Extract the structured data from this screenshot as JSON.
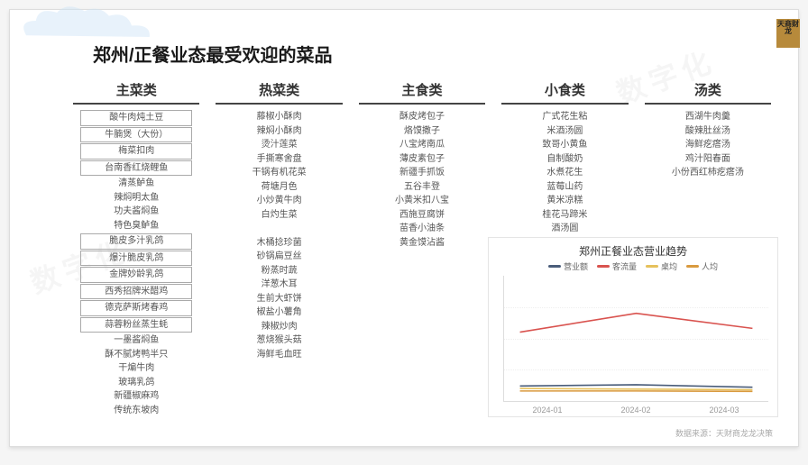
{
  "title": "郑州/正餐业态最受欢迎的菜品",
  "logo": "天商财龙",
  "columns": [
    {
      "header": "主菜类",
      "items": [
        {
          "t": "酸牛肉炖土豆",
          "b": 1
        },
        {
          "t": "牛腩煲（大份）",
          "b": 1
        },
        {
          "t": "梅菜扣肉",
          "b": 1
        },
        {
          "t": "台南香红烧鲤鱼",
          "b": 1
        },
        {
          "t": "清蒸鲈鱼",
          "b": 0
        },
        {
          "t": "辣焖明太鱼",
          "b": 0
        },
        {
          "t": "功夫酱焖鱼",
          "b": 0
        },
        {
          "t": "特色臭鲈鱼",
          "b": 0
        },
        {
          "t": "脆皮多汁乳鸽",
          "b": 1
        },
        {
          "t": "爆汁脆皮乳鸽",
          "b": 1
        },
        {
          "t": "金牌妙龄乳鸽",
          "b": 1
        },
        {
          "t": "西秀招牌米醋鸡",
          "b": 1
        },
        {
          "t": "德克萨斯烤春鸡",
          "b": 1
        },
        {
          "t": "蒜蓉粉丝蒸生蚝",
          "b": 1
        },
        {
          "t": "一墨酱焖鱼",
          "b": 0
        },
        {
          "t": "酥不腻烤鸭半只",
          "b": 0
        },
        {
          "t": "干煸牛肉",
          "b": 0
        },
        {
          "t": "玻璃乳鸽",
          "b": 0
        },
        {
          "t": "新疆椒麻鸡",
          "b": 0
        },
        {
          "t": "传统东坡肉",
          "b": 0
        }
      ]
    },
    {
      "header": "热菜类",
      "items": [
        {
          "t": "藤椒小酥肉",
          "b": 0
        },
        {
          "t": "辣焖小酥肉",
          "b": 0
        },
        {
          "t": "烫汁莲菜",
          "b": 0
        },
        {
          "t": "手撕寒舍盘",
          "b": 0
        },
        {
          "t": "干锅有机花菜",
          "b": 0
        },
        {
          "t": "荷塘月色",
          "b": 0
        },
        {
          "t": "小炒黄牛肉",
          "b": 0
        },
        {
          "t": "白灼生菜",
          "b": 0
        },
        {
          "t": "",
          "b": 0
        },
        {
          "t": "木桶捻珍菌",
          "b": 0
        },
        {
          "t": "砂锅扁豆丝",
          "b": 0
        },
        {
          "t": "粉蒸时蔬",
          "b": 0
        },
        {
          "t": "洋葱木耳",
          "b": 0
        },
        {
          "t": "生前大虾饼",
          "b": 0
        },
        {
          "t": "椒盐小薯角",
          "b": 0
        },
        {
          "t": "辣椒炒肉",
          "b": 0
        },
        {
          "t": "葱烧猴头菇",
          "b": 0
        },
        {
          "t": "海鲜毛血旺",
          "b": 0
        }
      ]
    },
    {
      "header": "主食类",
      "items": [
        {
          "t": "酥皮烤包子",
          "b": 0
        },
        {
          "t": "烙馍撒子",
          "b": 0
        },
        {
          "t": "八宝烤南瓜",
          "b": 0
        },
        {
          "t": "薄皮素包子",
          "b": 0
        },
        {
          "t": "新疆手抓饭",
          "b": 0
        },
        {
          "t": "五谷丰登",
          "b": 0
        },
        {
          "t": "小黄米扣八宝",
          "b": 0
        },
        {
          "t": "西施豆腐饼",
          "b": 0
        },
        {
          "t": "苗香小油条",
          "b": 0
        },
        {
          "t": "黄金馍沾酱",
          "b": 0
        }
      ]
    },
    {
      "header": "小食类",
      "items": [
        {
          "t": "广式花生粘",
          "b": 0
        },
        {
          "t": "米酒汤圆",
          "b": 0
        },
        {
          "t": "致哥小黄鱼",
          "b": 0
        },
        {
          "t": "自制酸奶",
          "b": 0
        },
        {
          "t": "水煮花生",
          "b": 0
        },
        {
          "t": "蓝莓山药",
          "b": 0
        },
        {
          "t": "黄米凉糕",
          "b": 0
        },
        {
          "t": "桂花马蹄米",
          "b": 0
        },
        {
          "t": "酒汤圆",
          "b": 0
        }
      ]
    },
    {
      "header": "汤类",
      "items": [
        {
          "t": "西湖牛肉羹",
          "b": 0
        },
        {
          "t": "酸辣肚丝汤",
          "b": 0
        },
        {
          "t": "海鲜疙瘩汤",
          "b": 0
        },
        {
          "t": "鸡汁阳春面",
          "b": 0
        },
        {
          "t": "小份西红柿疙瘩汤",
          "b": 0
        }
      ]
    }
  ],
  "chart_data": {
    "type": "line",
    "title": "郑州正餐业态营业趋势",
    "x": [
      "2024-01",
      "2024-02",
      "2024-03"
    ],
    "series": [
      {
        "name": "营业额",
        "color": "#4a5d7a",
        "values": [
          12,
          13,
          11
        ]
      },
      {
        "name": "客流量",
        "color": "#d9534f",
        "values": [
          55,
          70,
          58
        ]
      },
      {
        "name": "桌均",
        "color": "#e6c15c",
        "values": [
          10,
          9.5,
          9
        ]
      },
      {
        "name": "人均",
        "color": "#d99a3f",
        "values": [
          8,
          8,
          7.7
        ]
      }
    ],
    "ylim": [
      0,
      100
    ]
  },
  "footer": "数据来源：天财商龙龙决策"
}
